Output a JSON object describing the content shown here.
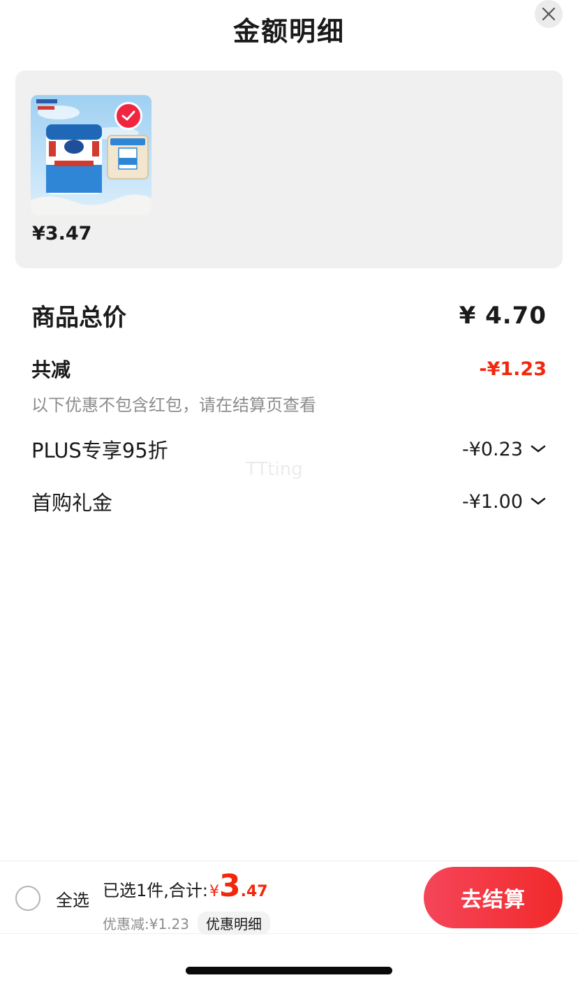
{
  "header": {
    "title": "金额明细"
  },
  "product": {
    "price": "¥3.47"
  },
  "summary": {
    "total_label": "商品总价",
    "total_value": "¥ 4.70",
    "reduce_label": "共减",
    "reduce_value": "-¥1.23",
    "note": "以下优惠不包含红包，请在结算页查看",
    "discounts": [
      {
        "label": "PLUS专享95折",
        "value": "-¥0.23"
      },
      {
        "label": "首购礼金",
        "value": "-¥1.00"
      }
    ]
  },
  "watermark": "TTting",
  "footer": {
    "select_all": "全选",
    "selected_text": "已选1件,合计:",
    "currency": "¥",
    "amount_int": "3",
    "amount_dec": ".47",
    "discount_text": "优惠减:¥1.23",
    "detail_label": "优惠明细",
    "checkout_label": "去结算"
  },
  "colors": {
    "accent": "#f2270c",
    "button": "#f5455a",
    "card_bg": "#f0f0f0"
  }
}
